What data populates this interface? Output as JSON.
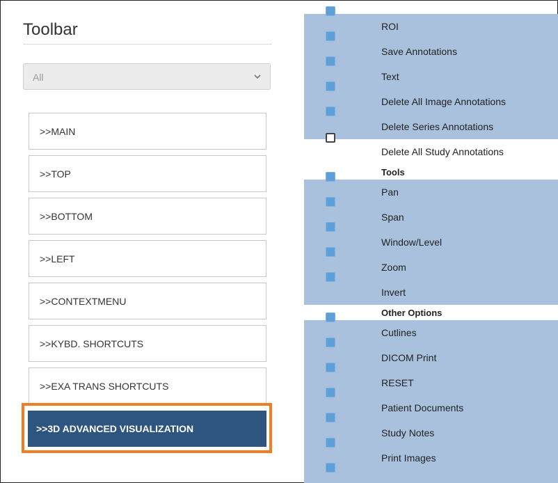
{
  "toolbar": {
    "title": "Toolbar"
  },
  "filter": {
    "selected": "All"
  },
  "nav_items": [
    ">>MAIN",
    ">>TOP",
    ">>BOTTOM",
    ">>LEFT",
    ">>CONTEXTMENU",
    ">>KYBD. SHORTCUTS",
    ">>EXA TRANS SHORTCUTS"
  ],
  "active_item": ">>3D ADVANCED VISUALIZATION",
  "options": {
    "annotations": [
      {
        "label": "ROI",
        "checked": true
      },
      {
        "label": "Save Annotations",
        "checked": true
      },
      {
        "label": "Text",
        "checked": true
      },
      {
        "label": "Delete All Image Annotations",
        "checked": true
      },
      {
        "label": "Delete Series Annotations",
        "checked": true
      },
      {
        "label": "Delete All Study Annotations",
        "checked": false
      }
    ],
    "tools_header": "Tools",
    "tools": [
      {
        "label": "Pan",
        "checked": true
      },
      {
        "label": "Span",
        "checked": true
      },
      {
        "label": "Window/Level",
        "checked": true
      },
      {
        "label": "Zoom",
        "checked": true
      },
      {
        "label": "Invert",
        "checked": true
      }
    ],
    "other_header": "Other Options",
    "other": [
      {
        "label": "Cutlines",
        "checked": true
      },
      {
        "label": "DICOM Print",
        "checked": true
      },
      {
        "label": "RESET",
        "checked": true
      },
      {
        "label": "Patient Documents",
        "checked": true
      },
      {
        "label": "Study Notes",
        "checked": true
      },
      {
        "label": "Print Images",
        "checked": true
      }
    ]
  },
  "colors": {
    "accent": "#2e5480",
    "highlight_border": "#f07d22",
    "row_bg": "#a9c1dc",
    "checkbox": "#5e9fd8"
  }
}
